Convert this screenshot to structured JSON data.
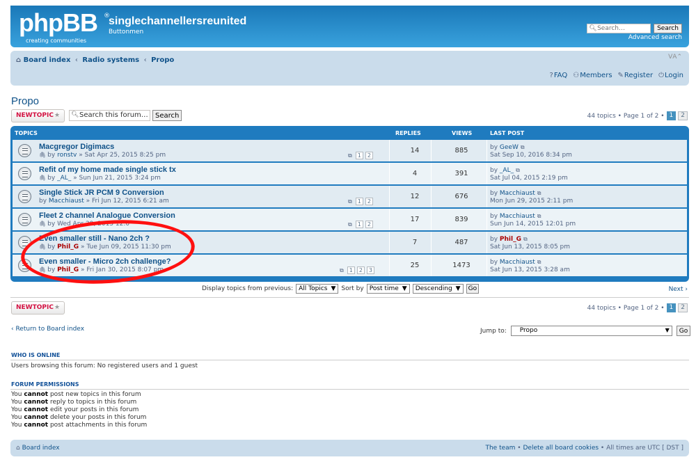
{
  "header": {
    "logo_text": "phpBB",
    "logo_tag_1": "creating",
    "logo_tag_2": "communities",
    "logo_reg": "®",
    "site_title": "singlechannellersreunited",
    "site_desc": "Buttonmen",
    "search_placeholder": "Search…",
    "search_button": "Search",
    "advanced_search": "Advanced search"
  },
  "navbar": {
    "crumbs": [
      "Board index",
      "Radio systems",
      "Propo"
    ],
    "crumb_sep": "‹",
    "font_control": "ᐯA⌃",
    "links": [
      {
        "icon": "?",
        "label": "FAQ"
      },
      {
        "icon": "⚇",
        "label": "Members"
      },
      {
        "icon": "✎",
        "label": "Register"
      },
      {
        "icon": "⏻",
        "label": "Login"
      }
    ]
  },
  "page": {
    "title": "Propo",
    "new_topic_label": "NEWTOPIC",
    "new_topic_star": "★",
    "forum_search_placeholder": "Search this forum…",
    "forum_search_button": "Search",
    "pagination_text": "44 topics • Page 1 of 2 •",
    "pages": [
      "1",
      "2"
    ]
  },
  "table": {
    "headers": {
      "topics": "TOPICS",
      "replies": "REPLIES",
      "views": "VIEWS",
      "last_post": "LAST POST"
    },
    "rows": [
      {
        "title": "Macgregor Digimacs",
        "clip": "🖇",
        "by": "by",
        "author": "ronstv",
        "author_red": false,
        "date": "» Sat Apr 25, 2015 8:25 pm",
        "pages": [
          "1",
          "2"
        ],
        "replies": "14",
        "views": "885",
        "lp_by": "by",
        "lp_author": "GeeW",
        "lp_red": false,
        "lp_date": "Sat Sep 10, 2016 8:34 pm"
      },
      {
        "title": "Refit of my home made single stick tx",
        "clip": "🖇",
        "by": "by",
        "author": "_AL_",
        "author_red": false,
        "date": "» Sun Jun 21, 2015 3:24 pm",
        "pages": [],
        "replies": "4",
        "views": "391",
        "lp_by": "by",
        "lp_author": "_AL_",
        "lp_red": false,
        "lp_date": "Sat Jul 04, 2015 2:19 pm"
      },
      {
        "title": "Single Stick JR PCM 9 Conversion",
        "clip": "",
        "by": "by",
        "author": "Macchiaust",
        "author_red": false,
        "date": "» Fri Jun 12, 2015 6:21 am",
        "pages": [
          "1",
          "2"
        ],
        "replies": "12",
        "views": "676",
        "lp_by": "by",
        "lp_author": "Macchiaust",
        "lp_red": false,
        "lp_date": "Mon Jun 29, 2015 2:11 pm"
      },
      {
        "title": "Fleet 2 channel Analogue Conversion",
        "clip": "🖇",
        "by": "by",
        "author": "",
        "author_red": false,
        "date": "Wed Apr 29, 2015 12:0",
        "pages": [
          "1",
          "2"
        ],
        "replies": "17",
        "views": "839",
        "lp_by": "by",
        "lp_author": "Macchiaust",
        "lp_red": false,
        "lp_date": "Sun Jun 14, 2015 12:01 pm"
      },
      {
        "title": "Even smaller still - Nano 2ch ?",
        "clip": "🖇",
        "by": "by",
        "author": "Phil_G",
        "author_red": true,
        "date": "» Tue Jun 09, 2015 11:30 pm",
        "pages": [],
        "replies": "7",
        "views": "487",
        "lp_by": "by",
        "lp_author": "Phil_G",
        "lp_red": true,
        "lp_date": "Sat Jun 13, 2015 8:05 pm"
      },
      {
        "title": "Even smaller - Micro 2ch challenge?",
        "clip": "🖇",
        "by": "by",
        "author": "Phil_G",
        "author_red": true,
        "date": "» Fri Jan 30, 2015 8:07 pm",
        "pages": [
          "1",
          "2",
          "3"
        ],
        "replies": "25",
        "views": "1473",
        "lp_by": "by",
        "lp_author": "Macchiaust",
        "lp_red": false,
        "lp_date": "Sat Jun 13, 2015 3:28 am"
      }
    ]
  },
  "filter": {
    "display_label": "Display topics from previous:",
    "display_value": "All Topics",
    "sort_label": "Sort by",
    "sort_value": "Post time",
    "order_value": "Descending",
    "go": "Go",
    "next": "Next ›"
  },
  "bottom": {
    "return_link": "‹ Return to Board index",
    "jump_label": "Jump to:",
    "jump_value": "Propo",
    "jump_go": "Go"
  },
  "who_online": {
    "heading": "WHO IS ONLINE",
    "text": "Users browsing this forum: No registered users and 1 guest"
  },
  "permissions": {
    "heading": "FORUM PERMISSIONS",
    "lines": [
      {
        "pre": "You ",
        "b": "cannot",
        "post": " post new topics in this forum"
      },
      {
        "pre": "You ",
        "b": "cannot",
        "post": " reply to topics in this forum"
      },
      {
        "pre": "You ",
        "b": "cannot",
        "post": " edit your posts in this forum"
      },
      {
        "pre": "You ",
        "b": "cannot",
        "post": " delete your posts in this forum"
      },
      {
        "pre": "You ",
        "b": "cannot",
        "post": " post attachments in this forum"
      }
    ]
  },
  "footer": {
    "board_index": "Board index",
    "team": "The team",
    "delete_cookies": "Delete all board cookies",
    "times": "• All times are UTC [ DST ]",
    "sep": "•"
  },
  "colors": {
    "accent": "#1f7bbf",
    "red_user": "#aa0000",
    "annotation": "#ff1010"
  }
}
